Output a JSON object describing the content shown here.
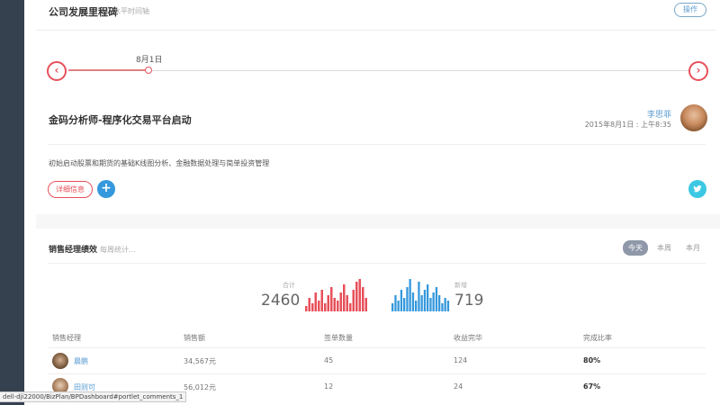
{
  "milestone": {
    "title": "公司发展里程碑",
    "subtitle": "水平时间轴",
    "ops_label": "操作",
    "timeline_date": "8月1日",
    "event_title": "金码分析师-程序化交易平台启动",
    "author_name": "李思菲",
    "author_date": "2015年8月1日 : 上午8:35",
    "description": "初始启动股票和期货的基础K线图分析、金融数据处理与简单投资管理",
    "detail_label": "详细信息",
    "plus_label": "+"
  },
  "sales": {
    "title": "销售经理绩效",
    "subtitle": "每周统计...",
    "ranges": [
      "今天",
      "本周",
      "本月"
    ],
    "total_label": "合计",
    "total_value": "2460",
    "new_label": "新增",
    "new_value": "719",
    "columns": [
      "销售经理",
      "销售额",
      "签单数量",
      "收益完华",
      "完成比率"
    ],
    "rows": [
      {
        "name": "晨鹏",
        "amount": "34,567元",
        "count": "45",
        "profit": "124",
        "rate": "80%"
      },
      {
        "name": "田则可",
        "amount": "56,012元",
        "count": "12",
        "profit": "24",
        "rate": "67%"
      }
    ],
    "spark_total": [
      2,
      5,
      3,
      7,
      4,
      8,
      3,
      6,
      9,
      5,
      4,
      7,
      10,
      6,
      3,
      8,
      11,
      12,
      9,
      5
    ],
    "spark_new": [
      3,
      6,
      4,
      8,
      5,
      9,
      12,
      7,
      4,
      11,
      6,
      8,
      10,
      5,
      7,
      9,
      6,
      3,
      5,
      4
    ],
    "colors": {
      "total": "#e7505a",
      "new": "#3598dc"
    }
  },
  "status_bar": {
    "url": "dell-dji22000/BizPlan/BPDashboard#portlet_comments_1"
  },
  "icons": {
    "prev": "chevron-left-icon",
    "next": "chevron-right-icon",
    "twitter": "twitter-icon"
  }
}
